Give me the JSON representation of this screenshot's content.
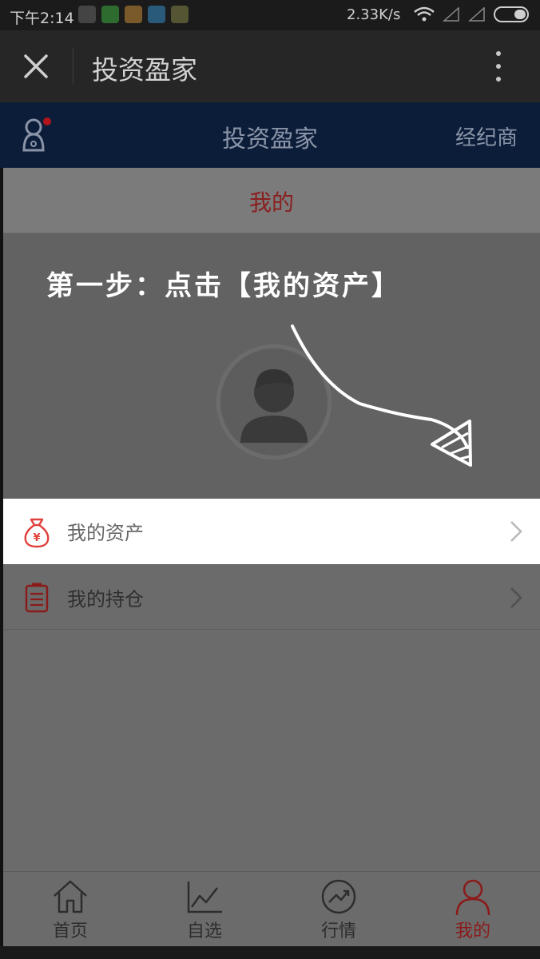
{
  "status_bar": {
    "time": "下午2:14",
    "speed": "2.33K/s"
  },
  "webview": {
    "title": "投资盈家"
  },
  "app_header": {
    "title": "投资盈家",
    "broker_label": "经纪商"
  },
  "page": {
    "title": "我的",
    "instruction": "第一步：点击【我的资产】"
  },
  "menu": {
    "items": [
      {
        "label": "我的资产",
        "icon": "money-bag-icon"
      },
      {
        "label": "我的持仓",
        "icon": "document-icon"
      }
    ]
  },
  "bottom_nav": {
    "tabs": [
      {
        "label": "首页",
        "icon": "home-icon"
      },
      {
        "label": "自选",
        "icon": "line-chart-icon"
      },
      {
        "label": "行情",
        "icon": "trend-up-icon"
      },
      {
        "label": "我的",
        "icon": "person-icon"
      }
    ],
    "active_index": 3
  },
  "colors": {
    "accent_red": "#8b1a1a",
    "icon_red": "#e0403a",
    "header_blue": "#0c1d3a"
  }
}
